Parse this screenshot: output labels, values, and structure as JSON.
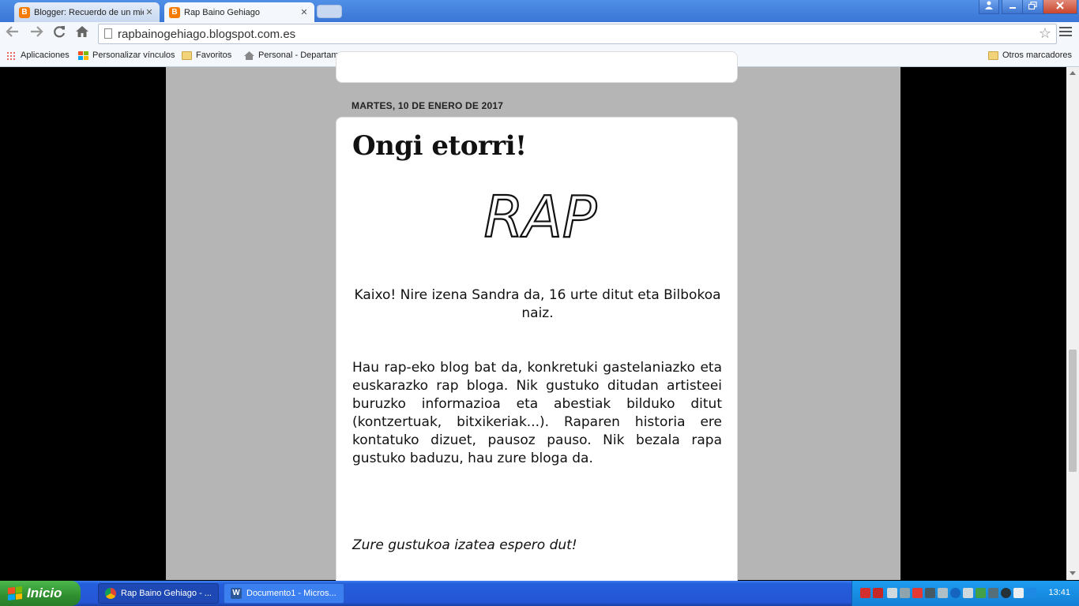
{
  "browser": {
    "tabs": [
      {
        "title": "Blogger: Recuerdo de un mie",
        "active": false,
        "favicon": "blogger-icon"
      },
      {
        "title": "Rap Baino Gehiago",
        "active": true,
        "favicon": "blogger-icon"
      }
    ],
    "favicon_letter": "B",
    "close_glyph": "✕",
    "url": "rapbainogehiago.blogspot.com.es",
    "bookmarks": [
      {
        "label": "Aplicaciones",
        "icon": "apps-grid-icon"
      },
      {
        "label": "Personalizar vínculos",
        "icon": "windows-icon"
      },
      {
        "label": "Favoritos",
        "icon": "folder-icon"
      },
      {
        "label": "Personal - Departament",
        "icon": "house-icon"
      }
    ],
    "other_bookmarks": "Otros marcadores"
  },
  "blog": {
    "date_header": "MARTES, 10 DE ENERO DE 2017",
    "post_title": "Ongi etorri!",
    "art_text": "RAP",
    "intro": "Kaixo! Nire izena Sandra da, 16 urte ditut eta Bilbokoa naiz.",
    "body": "Hau rap-eko blog bat da, konkretuki gastelaniazko eta euskarazko rap bloga. Nik gustuko ditudan artisteei buruzko informazioa eta abestiak bilduko ditut (kontzertuak, bitxikeriak...). Raparen historia ere kontatuko dizuet, pausoz pauso. Nik bezala rapa gustuko baduzu, hau zure bloga da.",
    "closing": "Zure gustukoa izatea espero dut!"
  },
  "taskbar": {
    "start_label": "Inicio",
    "tasks": [
      {
        "label": "Rap Baino Gehiago - ...",
        "active": true,
        "icon": "chrome-icon"
      },
      {
        "label": "Documento1 - Micros...",
        "active": false,
        "icon": "word-icon"
      }
    ],
    "clock": "13:41"
  },
  "colors": {
    "blog_background": "#b5b5b5",
    "page_side": "#000000",
    "tab_active": "#f4f7fb",
    "xp_taskbar": "#245edb",
    "start_green": "#3c9a3c"
  }
}
